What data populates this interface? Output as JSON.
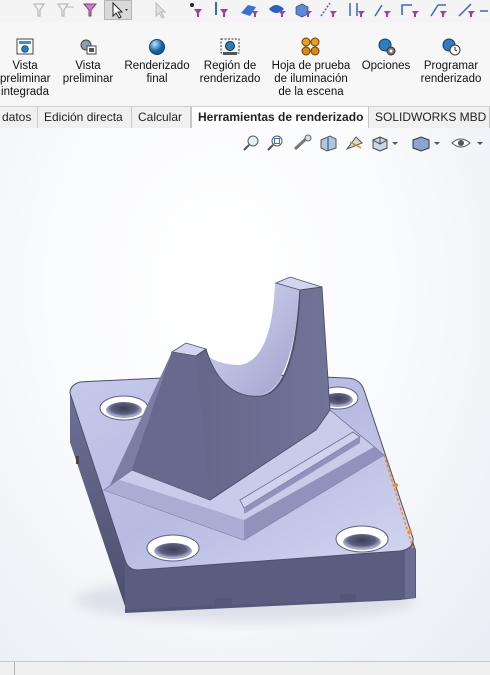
{
  "ribbon": {
    "buttons": [
      {
        "label": "Vista\npreliminar\nintegrada",
        "icon": "integrated-preview-icon"
      },
      {
        "label": "Vista\npreliminar",
        "icon": "preview-window-icon"
      },
      {
        "label": "Renderizado\nfinal",
        "icon": "final-render-icon"
      },
      {
        "label": "Región de\nrenderizado",
        "icon": "render-region-icon"
      },
      {
        "label": "Hoja de prueba\nde iluminación\nde la escena",
        "icon": "scene-proof-sheet-icon"
      },
      {
        "label": "Opciones",
        "icon": "options-gear-icon"
      },
      {
        "label": "Programar\nrenderizado",
        "icon": "schedule-render-icon"
      }
    ]
  },
  "tabs": [
    {
      "label": "datos"
    },
    {
      "label": "Edición directa"
    },
    {
      "label": "Calcular"
    },
    {
      "label": "Herramientas de renderizado",
      "active": true
    },
    {
      "label": "SOLIDWORKS MBD"
    }
  ],
  "heads_up_toolbar": [
    "zoom-to-fit-icon",
    "zoom-to-area-icon",
    "previous-view-icon",
    "section-view-icon",
    "dynamic-annotation-icon",
    "view-orientation-icon",
    "display-style-icon",
    "hide-show-items-icon"
  ],
  "model": {
    "color": "#8d90b4",
    "description_icon": "bracket-part-3d-model"
  }
}
